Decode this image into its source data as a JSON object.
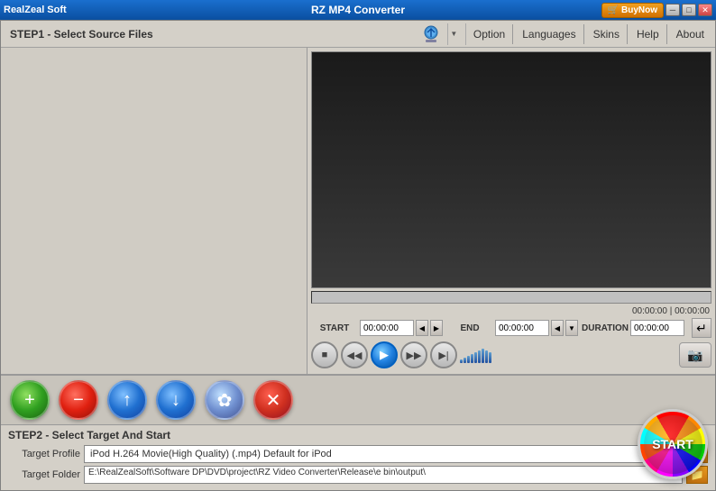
{
  "app": {
    "vendor": "RealZeal Soft",
    "title": "RZ MP4 Converter",
    "buynow_label": "BuyNow"
  },
  "menu": {
    "option_label": "Option",
    "languages_label": "Languages",
    "skins_label": "Skins",
    "help_label": "Help",
    "about_label": "About"
  },
  "step1": {
    "label": "STEP1 - Select Source Files"
  },
  "step2": {
    "label": "STEP2 - Select Target And Start",
    "target_profile_label": "Target Profile",
    "target_folder_label": "Target Folder",
    "profile_value": "iPod H.264 Movie(High Quality) (.mp4) Default for iPod",
    "folder_value": "E:\\RealZealSoft\\Software DP\\DVD\\project\\RZ Video Converter\\Release\\e bin\\output\\"
  },
  "controls": {
    "start_label": "START",
    "stop_label": "■",
    "rewind_label": "◀◀",
    "play_label": "▶",
    "fastfwd_label": "▶▶",
    "stepfwd_label": "▶|",
    "enter_symbol": "↵"
  },
  "timecodes": {
    "start_label": "START",
    "end_label": "END",
    "duration_label": "DURATION",
    "start_value": "00:00:00",
    "end_value": "00:00:00",
    "duration_value": "00:00:00",
    "time_display": "00:00:00 | 00:00:00"
  },
  "action_buttons": {
    "add_label": "+",
    "remove_label": "−",
    "up_label": "↑",
    "down_label": "↓",
    "settings_label": "✿",
    "clear_label": "✕"
  },
  "title_buttons": {
    "minimize": "─",
    "maximize": "□",
    "close": "✕"
  },
  "volume_bars": [
    4,
    6,
    8,
    10,
    12,
    14,
    16,
    14,
    12
  ]
}
